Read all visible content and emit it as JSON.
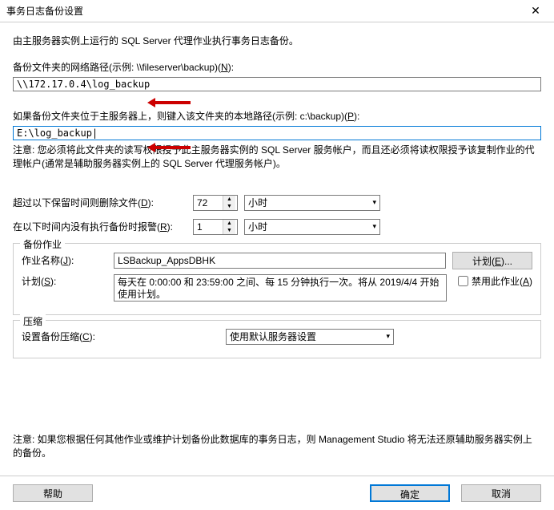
{
  "titlebar": {
    "title": "事务日志备份设置"
  },
  "intro": "由主服务器实例上运行的 SQL Server 代理作业执行事务日志备份。",
  "netpath": {
    "label_pre": "备份文件夹的网络路径(示例: \\\\fileserver\\backup)(",
    "access": "N",
    "label_post": "):",
    "value": "\\\\172.17.0.4\\log_backup"
  },
  "localpath": {
    "label_pre": "如果备份文件夹位于主服务器上，则键入该文件夹的本地路径(示例: c:\\backup)(",
    "access": "P",
    "label_post": "):",
    "value": "E:\\log_backup|",
    "note": "注意: 您必须将此文件夹的读写权限授予此主服务器实例的 SQL Server 服务帐户，而且还必须将读权限授予该复制作业的代理帐户(通常是辅助服务器实例上的 SQL Server 代理服务帐户)。"
  },
  "retention": {
    "label_pre": "超过以下保留时间则删除文件(",
    "access": "D",
    "label_post": "):",
    "value": "72",
    "unit": "小时"
  },
  "alert": {
    "label_pre": "在以下时间内没有执行备份时报警(",
    "access": "R",
    "label_post": "):",
    "value": "1",
    "unit": "小时"
  },
  "job_section": {
    "legend": "备份作业",
    "jobname_label_pre": "作业名称(",
    "jobname_access": "J",
    "jobname_label_post": "):",
    "jobname_value": "LSBackup_AppsDBHK",
    "schedule_btn_pre": "计划(",
    "schedule_btn_access": "E",
    "schedule_btn_post": ")...",
    "schedule_label_pre": "计划(",
    "schedule_access": "S",
    "schedule_label_post": "):",
    "schedule_text": "每天在 0:00:00 和 23:59:00 之间、每 15 分钟执行一次。将从 2019/4/4 开始使用计划。",
    "disable_label_pre": "禁用此作业(",
    "disable_access": "A",
    "disable_label_post": ")"
  },
  "compress_section": {
    "legend": "压缩",
    "label_pre": "设置备份压缩(",
    "access": "C",
    "label_post": "):",
    "value": "使用默认服务器设置"
  },
  "warning": "注意: 如果您根据任何其他作业或维护计划备份此数据库的事务日志，则 Management Studio 将无法还原辅助服务器实例上的备份。",
  "footer": {
    "help": "帮助",
    "ok": "确定",
    "cancel": "取消"
  }
}
